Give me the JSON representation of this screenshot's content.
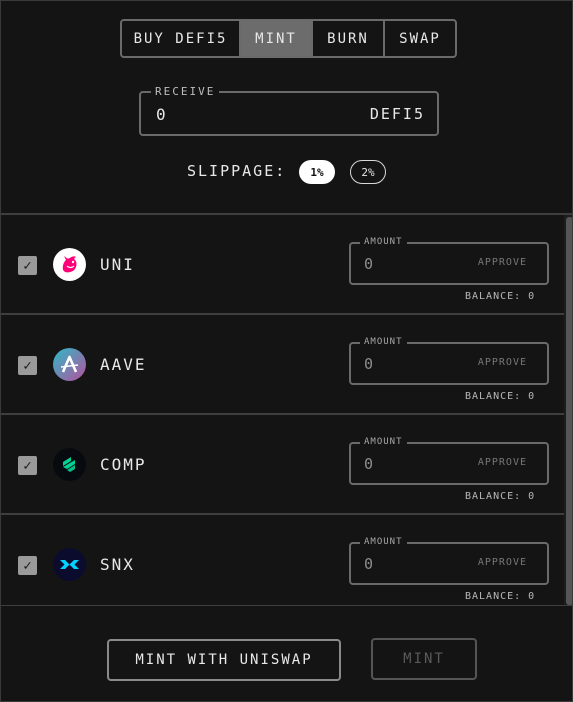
{
  "tabs": [
    {
      "label": "BUY DEFI5"
    },
    {
      "label": "MINT"
    },
    {
      "label": "BURN"
    },
    {
      "label": "SWAP"
    }
  ],
  "active_tab": "MINT",
  "receive": {
    "legend": "RECEIVE",
    "value": "0",
    "unit": "DEFI5"
  },
  "slippage": {
    "label": "SLIPPAGE:",
    "options": [
      "1%",
      "2%"
    ],
    "selected": "1%"
  },
  "tokens": [
    {
      "symbol": "UNI",
      "checked": true,
      "icon": "uniswap-unicorn-icon",
      "amount_legend": "AMOUNT",
      "amount": "0",
      "approve": "APPROVE",
      "balance": "BALANCE: 0"
    },
    {
      "symbol": "AAVE",
      "checked": true,
      "icon": "aave-logo-icon",
      "amount_legend": "AMOUNT",
      "amount": "0",
      "approve": "APPROVE",
      "balance": "BALANCE: 0"
    },
    {
      "symbol": "COMP",
      "checked": true,
      "icon": "compound-logo-icon",
      "amount_legend": "AMOUNT",
      "amount": "0",
      "approve": "APPROVE",
      "balance": "BALANCE: 0"
    },
    {
      "symbol": "SNX",
      "checked": true,
      "icon": "synthetix-logo-icon",
      "amount_legend": "AMOUNT",
      "amount": "0",
      "approve": "APPROVE",
      "balance": "BALANCE: 0"
    }
  ],
  "actions": {
    "mint_uniswap": "MINT WITH UNISWAP",
    "mint": "MINT"
  },
  "colors": {
    "background": "#141414",
    "active_tab": "#6c6c6c",
    "border": "#6a6a6a"
  }
}
